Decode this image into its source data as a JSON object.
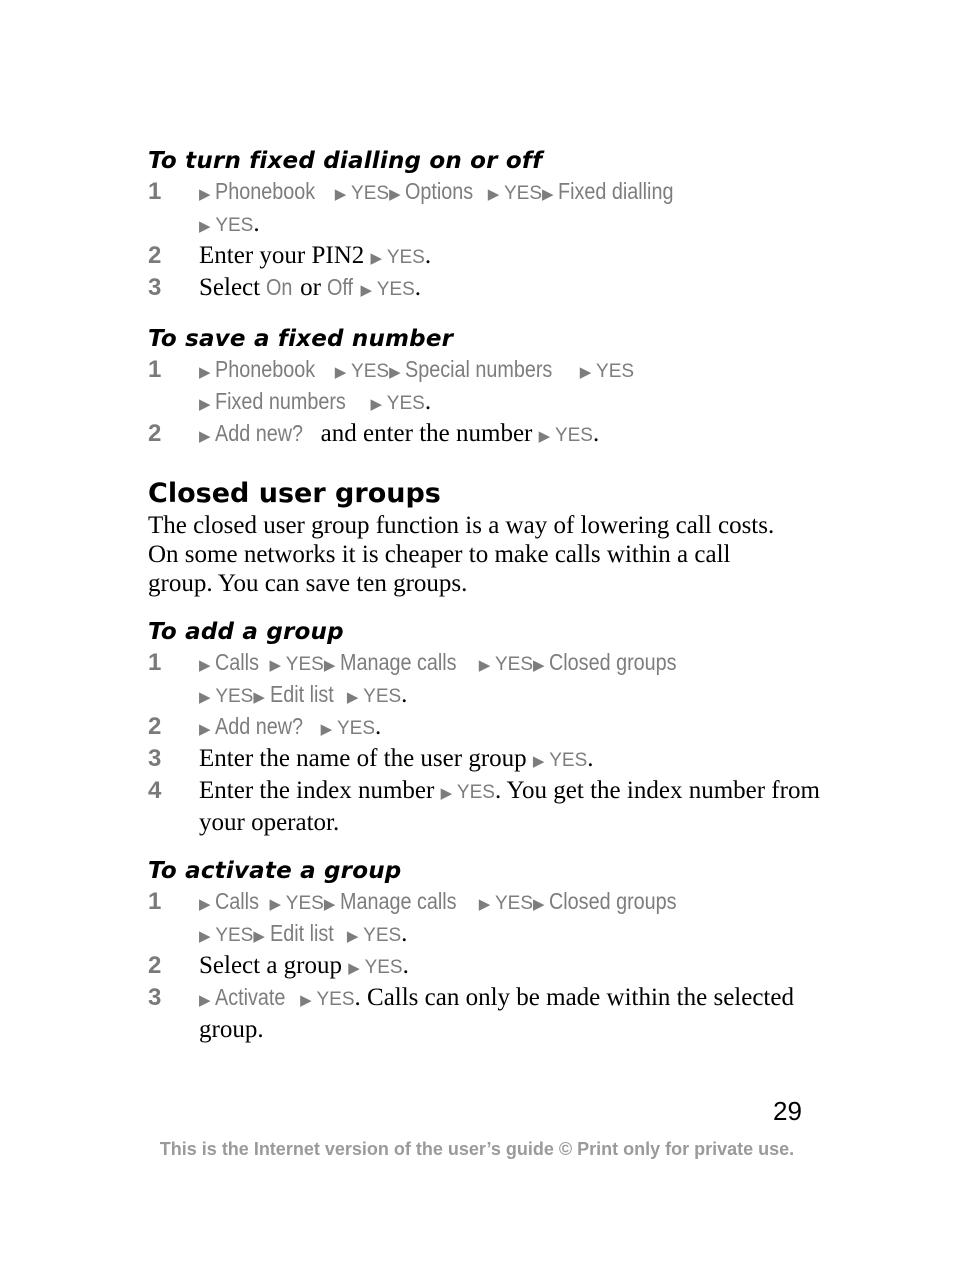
{
  "sections": [
    {
      "title": "To turn fixed dialling on or off",
      "steps": [
        {
          "num": "1",
          "parts": [
            [
              "a",
              ""
            ],
            [
              "m",
              "Phonebook"
            ],
            [
              "a",
              ""
            ],
            [
              "k",
              "YES"
            ],
            [
              "a",
              ""
            ],
            [
              "m",
              "Options"
            ],
            [
              "a",
              ""
            ],
            [
              "k",
              "YES"
            ],
            [
              "a",
              ""
            ],
            [
              "m",
              "Fixed dialling"
            ],
            [
              "br",
              ""
            ],
            [
              "a",
              ""
            ],
            [
              "k",
              "YES"
            ],
            [
              "t",
              "."
            ]
          ]
        },
        {
          "num": "2",
          "parts": [
            [
              "t",
              "Enter your PIN2 "
            ],
            [
              "a",
              ""
            ],
            [
              "k",
              "YES"
            ],
            [
              "t",
              "."
            ]
          ]
        },
        {
          "num": "3",
          "parts": [
            [
              "t",
              "Select "
            ],
            [
              "m",
              "On"
            ],
            [
              "t",
              " or "
            ],
            [
              "m",
              "Off"
            ],
            [
              "a",
              ""
            ],
            [
              "k",
              "YES"
            ],
            [
              "t",
              "."
            ]
          ]
        }
      ]
    },
    {
      "title": "To save a fixed number",
      "steps": [
        {
          "num": "1",
          "parts": [
            [
              "a",
              ""
            ],
            [
              "m",
              "Phonebook"
            ],
            [
              "a",
              ""
            ],
            [
              "k",
              "YES"
            ],
            [
              "a",
              ""
            ],
            [
              "m",
              "Special numbers"
            ],
            [
              "a",
              ""
            ],
            [
              "k",
              "YES"
            ],
            [
              "br",
              ""
            ],
            [
              "a",
              ""
            ],
            [
              "m",
              "Fixed numbers"
            ],
            [
              "a",
              ""
            ],
            [
              "k",
              "YES"
            ],
            [
              "t",
              "."
            ]
          ]
        },
        {
          "num": "2",
          "parts": [
            [
              "a",
              ""
            ],
            [
              "m",
              "Add new?"
            ],
            [
              "t",
              " and enter the number "
            ],
            [
              "a",
              ""
            ],
            [
              "k",
              "YES"
            ],
            [
              "t",
              "."
            ]
          ]
        }
      ]
    }
  ],
  "closed_user_groups": {
    "heading": "Closed user groups",
    "intro": "The closed user group function is a way of lowering call costs. On some networks it is cheaper to make calls within a call group. You can save ten groups."
  },
  "sections2": [
    {
      "title": "To add a group",
      "steps": [
        {
          "num": "1",
          "parts": [
            [
              "a",
              ""
            ],
            [
              "m",
              "Calls"
            ],
            [
              "a",
              ""
            ],
            [
              "k",
              "YES"
            ],
            [
              "a",
              ""
            ],
            [
              "m",
              "Manage calls"
            ],
            [
              "a",
              ""
            ],
            [
              "k",
              "YES"
            ],
            [
              "a",
              ""
            ],
            [
              "m",
              "Closed groups"
            ],
            [
              "br",
              ""
            ],
            [
              "a",
              ""
            ],
            [
              "k",
              "YES"
            ],
            [
              "a",
              ""
            ],
            [
              "m",
              "Edit list"
            ],
            [
              "a",
              ""
            ],
            [
              "k",
              "YES"
            ],
            [
              "t",
              "."
            ]
          ]
        },
        {
          "num": "2",
          "parts": [
            [
              "a",
              ""
            ],
            [
              "m",
              "Add new?"
            ],
            [
              "a",
              ""
            ],
            [
              "k",
              "YES"
            ],
            [
              "t",
              "."
            ]
          ]
        },
        {
          "num": "3",
          "parts": [
            [
              "t",
              "Enter the name of the user group "
            ],
            [
              "a",
              ""
            ],
            [
              "k",
              "YES"
            ],
            [
              "t",
              "."
            ]
          ]
        },
        {
          "num": "4",
          "parts": [
            [
              "t",
              "Enter the index number "
            ],
            [
              "a",
              ""
            ],
            [
              "k",
              "YES"
            ],
            [
              "t",
              ". You get the index number from your operator."
            ]
          ]
        }
      ]
    },
    {
      "title": "To activate a group",
      "steps": [
        {
          "num": "1",
          "parts": [
            [
              "a",
              ""
            ],
            [
              "m",
              "Calls"
            ],
            [
              "a",
              ""
            ],
            [
              "k",
              "YES"
            ],
            [
              "a",
              ""
            ],
            [
              "m",
              "Manage calls"
            ],
            [
              "a",
              ""
            ],
            [
              "k",
              "YES"
            ],
            [
              "a",
              ""
            ],
            [
              "m",
              "Closed groups"
            ],
            [
              "br",
              ""
            ],
            [
              "a",
              ""
            ],
            [
              "k",
              "YES"
            ],
            [
              "a",
              ""
            ],
            [
              "m",
              "Edit list"
            ],
            [
              "a",
              ""
            ],
            [
              "k",
              "YES"
            ],
            [
              "t",
              "."
            ]
          ]
        },
        {
          "num": "2",
          "parts": [
            [
              "t",
              "Select a group "
            ],
            [
              "a",
              ""
            ],
            [
              "k",
              "YES"
            ],
            [
              "t",
              "."
            ]
          ]
        },
        {
          "num": "3",
          "parts": [
            [
              "a",
              ""
            ],
            [
              "m",
              "Activate"
            ],
            [
              "a",
              ""
            ],
            [
              "k",
              "YES"
            ],
            [
              "t",
              ". Calls can only be made within the selected group."
            ]
          ]
        }
      ]
    }
  ],
  "page_number": "29",
  "footer": "This is the Internet version of the user’s guide © Print only for private use.",
  "icons": {
    "arrow": "▶"
  }
}
